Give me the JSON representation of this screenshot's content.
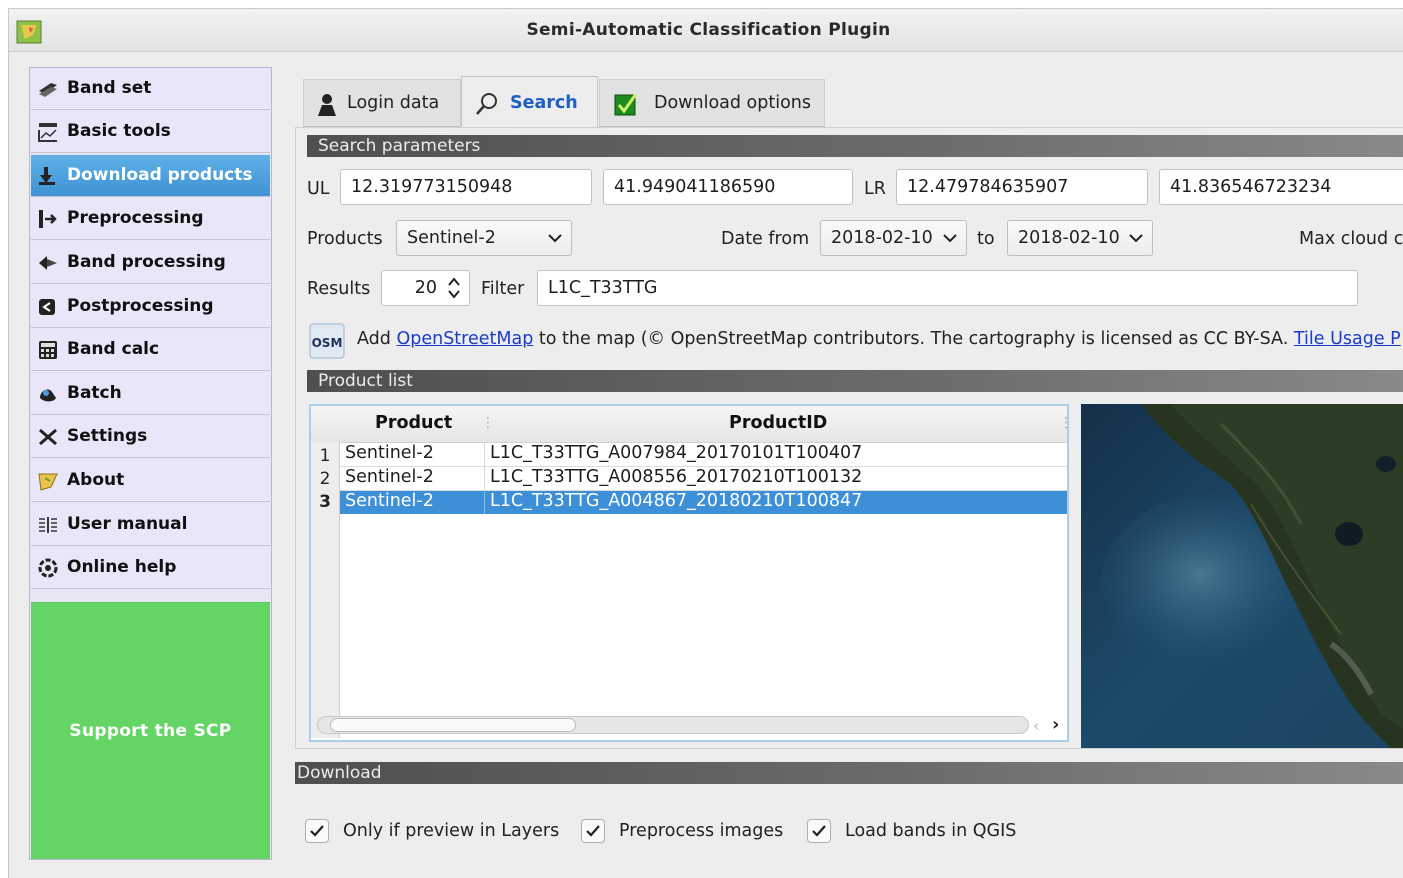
{
  "window": {
    "title": "Semi-Automatic Classification Plugin"
  },
  "sidebar": {
    "items": [
      {
        "label": "Band set",
        "icon": "band-set-icon"
      },
      {
        "label": "Basic tools",
        "icon": "basic-tools-icon"
      },
      {
        "label": "Download products",
        "icon": "download-icon"
      },
      {
        "label": "Preprocessing",
        "icon": "preprocessing-icon"
      },
      {
        "label": "Band processing",
        "icon": "band-processing-icon"
      },
      {
        "label": "Postprocessing",
        "icon": "postprocessing-icon"
      },
      {
        "label": "Band calc",
        "icon": "calculator-icon"
      },
      {
        "label": "Batch",
        "icon": "batch-icon"
      },
      {
        "label": "Settings",
        "icon": "settings-icon"
      },
      {
        "label": "About",
        "icon": "about-icon"
      },
      {
        "label": "User manual",
        "icon": "manual-icon"
      },
      {
        "label": "Online help",
        "icon": "help-icon"
      }
    ],
    "active_index": 2,
    "support_label": "Support the SCP"
  },
  "tabs": [
    {
      "label": "Login data",
      "icon": "user-icon"
    },
    {
      "label": "Search",
      "icon": "search-icon"
    },
    {
      "label": "Download options",
      "icon": "checkbox-icon"
    }
  ],
  "search": {
    "section_title": "Search parameters",
    "ul_label": "UL",
    "ul_x": "12.319773150948",
    "ul_y": "41.949041186590",
    "lr_label": "LR",
    "lr_x": "12.479784635907",
    "lr_y": "41.836546723234",
    "products_label": "Products",
    "products_value": "Sentinel-2",
    "date_from_label": "Date from",
    "date_from": "2018-02-10",
    "to_label": "to",
    "date_to": "2018-02-10",
    "max_cloud_label": "Max cloud c",
    "results_label": "Results",
    "results_value": "20",
    "filter_label": "Filter",
    "filter_value": "L1C_T33TTG"
  },
  "osm": {
    "badge": "OSM",
    "prefix": "Add ",
    "link": "OpenStreetMap",
    "middle": " to the map  (© OpenStreetMap contributors. The cartography is licensed as CC BY-SA. ",
    "link2": "Tile Usage P"
  },
  "product_list": {
    "section_title": "Product list",
    "columns": [
      "Product",
      "ProductID"
    ],
    "rows": [
      {
        "num": "1",
        "product": "Sentinel-2",
        "id": "L1C_T33TTG_A007984_20170101T100407"
      },
      {
        "num": "2",
        "product": "Sentinel-2",
        "id": "L1C_T33TTG_A008556_20170210T100132"
      },
      {
        "num": "3",
        "product": "Sentinel-2",
        "id": "L1C_T33TTG_A004867_20180210T100847"
      }
    ],
    "selected_row": 3
  },
  "download": {
    "section_title": "Download",
    "options": [
      {
        "label": "Only if preview in Layers",
        "checked": true
      },
      {
        "label": "Preprocess images",
        "checked": true
      },
      {
        "label": "Load bands in QGIS",
        "checked": true
      }
    ]
  },
  "colors": {
    "active_item": "#3f93d4",
    "support_bg": "#64d464",
    "selected_row": "#3d8fd8",
    "link": "#1a3cc8"
  }
}
